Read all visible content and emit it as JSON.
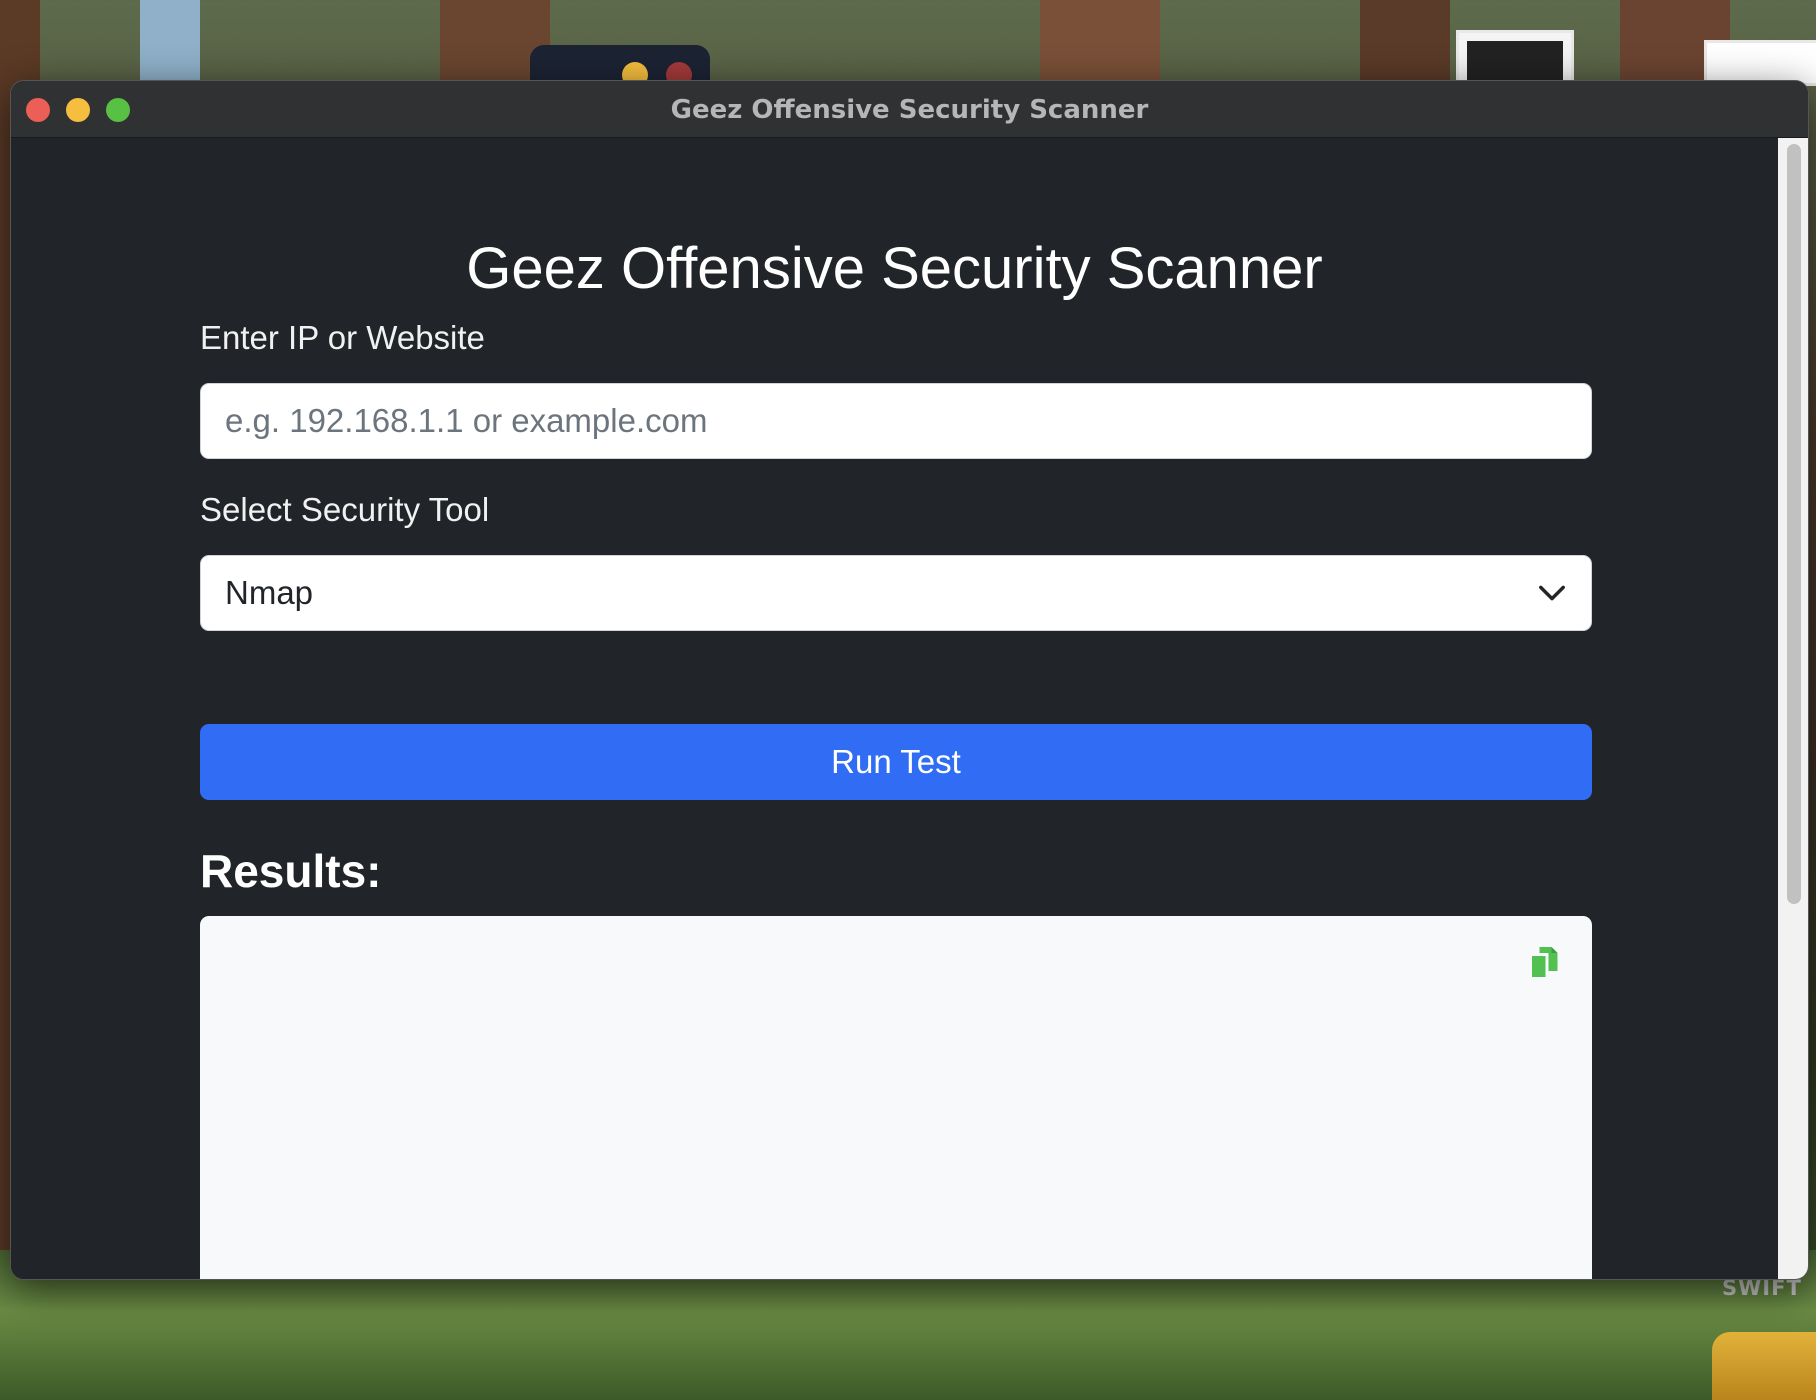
{
  "window": {
    "title": "Geez Offensive Security Scanner"
  },
  "app": {
    "heading": "Geez Offensive Security Scanner",
    "target_label": "Enter IP or Website",
    "target_placeholder": "e.g. 192.168.1.1 or example.com",
    "target_value": "",
    "tool_label": "Select Security Tool",
    "tool_selected": "Nmap",
    "run_button_label": "Run Test",
    "results_heading": "Results:",
    "results_text": ""
  },
  "desktop": {
    "dock_label": "SWIFT"
  },
  "colors": {
    "window_bg": "#212529",
    "primary_button": "#316cf4",
    "copy_icon": "#52c152",
    "results_bg": "#f8f9fa"
  },
  "icons": {
    "select_chevron": "chevron-down-icon",
    "copy": "copy-icon"
  }
}
